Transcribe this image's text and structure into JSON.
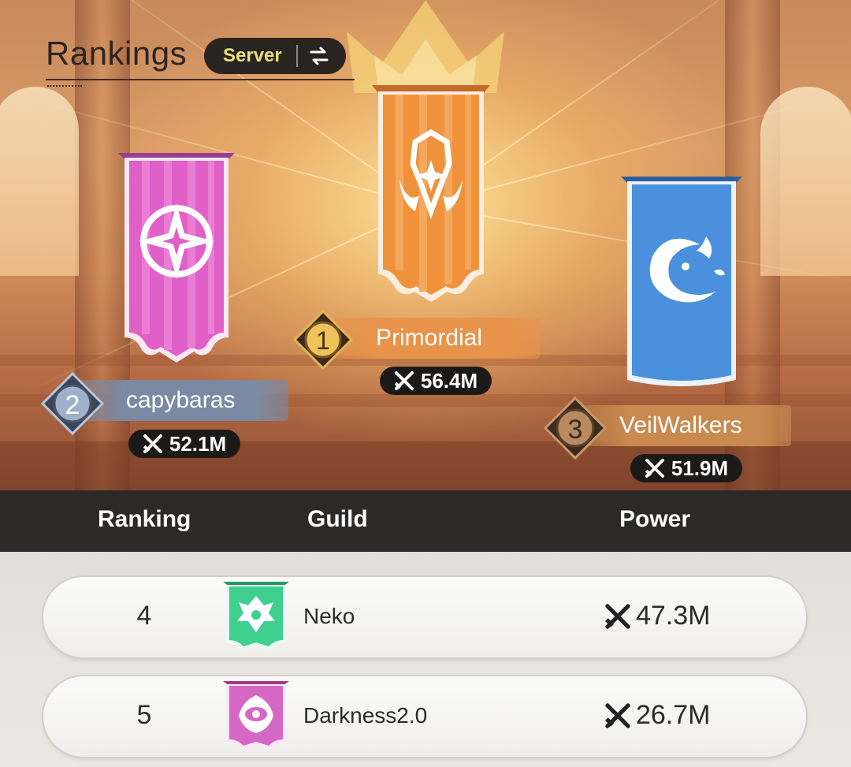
{
  "header": {
    "title": "Rankings",
    "scope_label": "Server",
    "swap_icon": "swap-arrows-icon"
  },
  "podium": [
    {
      "rank": "1",
      "guild": "Primordial",
      "power": "56.4M",
      "banner_color": "#f0923c",
      "emblem": "horned-helm-emblem-icon"
    },
    {
      "rank": "2",
      "guild": "capybaras",
      "power": "52.1M",
      "banner_color": "#e060c8",
      "emblem": "compass-star-emblem-icon"
    },
    {
      "rank": "3",
      "guild": "VeilWalkers",
      "power": "51.9M",
      "banner_color": "#4a90dc",
      "emblem": "dragon-crescent-emblem-icon"
    }
  ],
  "table": {
    "headers": {
      "ranking": "Ranking",
      "guild": "Guild",
      "power": "Power"
    },
    "rows": [
      {
        "rank": "4",
        "guild": "Neko",
        "power": "47.3M",
        "banner_color": "#3fcf8e",
        "emblem": "beast-emblem-icon"
      },
      {
        "rank": "5",
        "guild": "Darkness2.0",
        "power": "26.7M",
        "banner_color": "#d468c4",
        "emblem": "eye-emblem-icon"
      }
    ]
  },
  "colors": {
    "first_plate": "#e8934a",
    "second_plate": "#7b8aa3",
    "third_plate": "#c98a50",
    "header_bar": "#2b2a29",
    "server_label": "#e8e27a"
  },
  "power_icon": "crossed-swords-icon"
}
